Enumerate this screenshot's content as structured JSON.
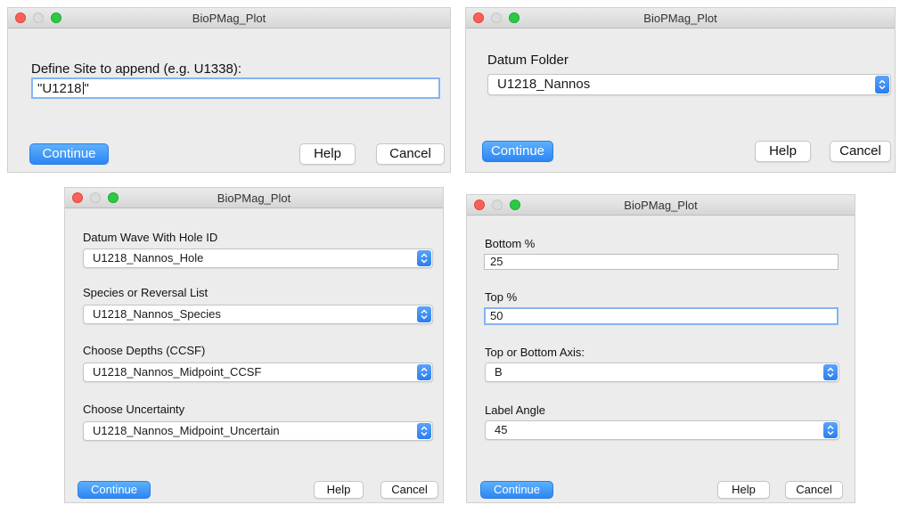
{
  "colors": {
    "accent": "#2d86f3",
    "window_bg": "#ececec",
    "close": "#fc5f57",
    "zoom": "#2acb42"
  },
  "dialogs": [
    {
      "title": "BioPMag_Plot",
      "prompt_label": "Define Site to append (e.g. U1338):",
      "site_value_before_cursor": "\"U1218",
      "site_value_after_cursor": "\"",
      "continue_label": "Continue",
      "help_label": "Help",
      "cancel_label": "Cancel"
    },
    {
      "title": "BioPMag_Plot",
      "datum_folder_label": "Datum Folder",
      "datum_folder_value": "U1218_Nannos",
      "continue_label": "Continue",
      "help_label": "Help",
      "cancel_label": "Cancel"
    },
    {
      "title": "BioPMag_Plot",
      "fields": [
        {
          "label": "Datum Wave With Hole ID",
          "value": "U1218_Nannos_Hole"
        },
        {
          "label": "Species or Reversal List",
          "value": "U1218_Nannos_Species"
        },
        {
          "label": "Choose Depths (CCSF)",
          "value": "U1218_Nannos_Midpoint_CCSF"
        },
        {
          "label": "Choose Uncertainty",
          "value": "U1218_Nannos_Midpoint_Uncertain"
        }
      ],
      "continue_label": "Continue",
      "help_label": "Help",
      "cancel_label": "Cancel"
    },
    {
      "title": "BioPMag_Plot",
      "bottom_label": "Bottom %",
      "bottom_value": "25",
      "top_label": "Top %",
      "top_value": "50",
      "axis_label": "Top or Bottom Axis:",
      "axis_value": "B",
      "angle_label": "Label Angle",
      "angle_value": "45",
      "continue_label": "Continue",
      "help_label": "Help",
      "cancel_label": "Cancel"
    }
  ]
}
